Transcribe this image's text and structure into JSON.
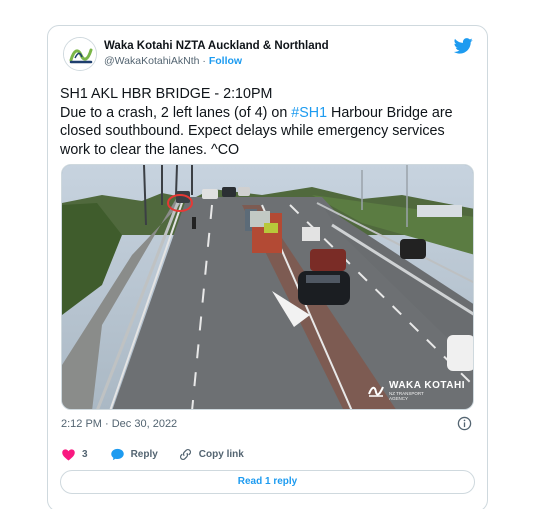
{
  "author": {
    "name": "Waka Kotahi NZTA Auckland & Northland",
    "handle": "@WakaKotahiAkNth",
    "separator": "·",
    "follow_label": "Follow"
  },
  "tweet": {
    "line1": "SH1 AKL HBR BRIDGE - 2:10PM",
    "line2_before": "Due to a crash, 2 left lanes (of 4) on ",
    "line2_hashtag": "#SH1",
    "line2_after": " Harbour Bridge are",
    "line3": "closed southbound.  Expect delays while emergency services",
    "line4": "work to clear the lanes. ^CO"
  },
  "media": {
    "watermark_title": "WAKA KOTAHI",
    "watermark_sub1": "NZ TRANSPORT",
    "watermark_sub2": "AGENCY"
  },
  "timestamp": "2:12 PM · Dec 30, 2022",
  "actions": {
    "likes": "3",
    "reply_label": "Reply",
    "copy_link_label": "Copy link"
  },
  "read_replies_label": "Read 1 reply",
  "colors": {
    "accent": "#1d9bf0",
    "like": "#f91880",
    "text": "#0f1419",
    "muted": "#536471",
    "border": "#cfd9de"
  },
  "icons": [
    "waka-kotahi-logo-icon",
    "twitter-bird-icon",
    "info-icon",
    "heart-icon",
    "reply-bubble-icon",
    "link-icon"
  ]
}
